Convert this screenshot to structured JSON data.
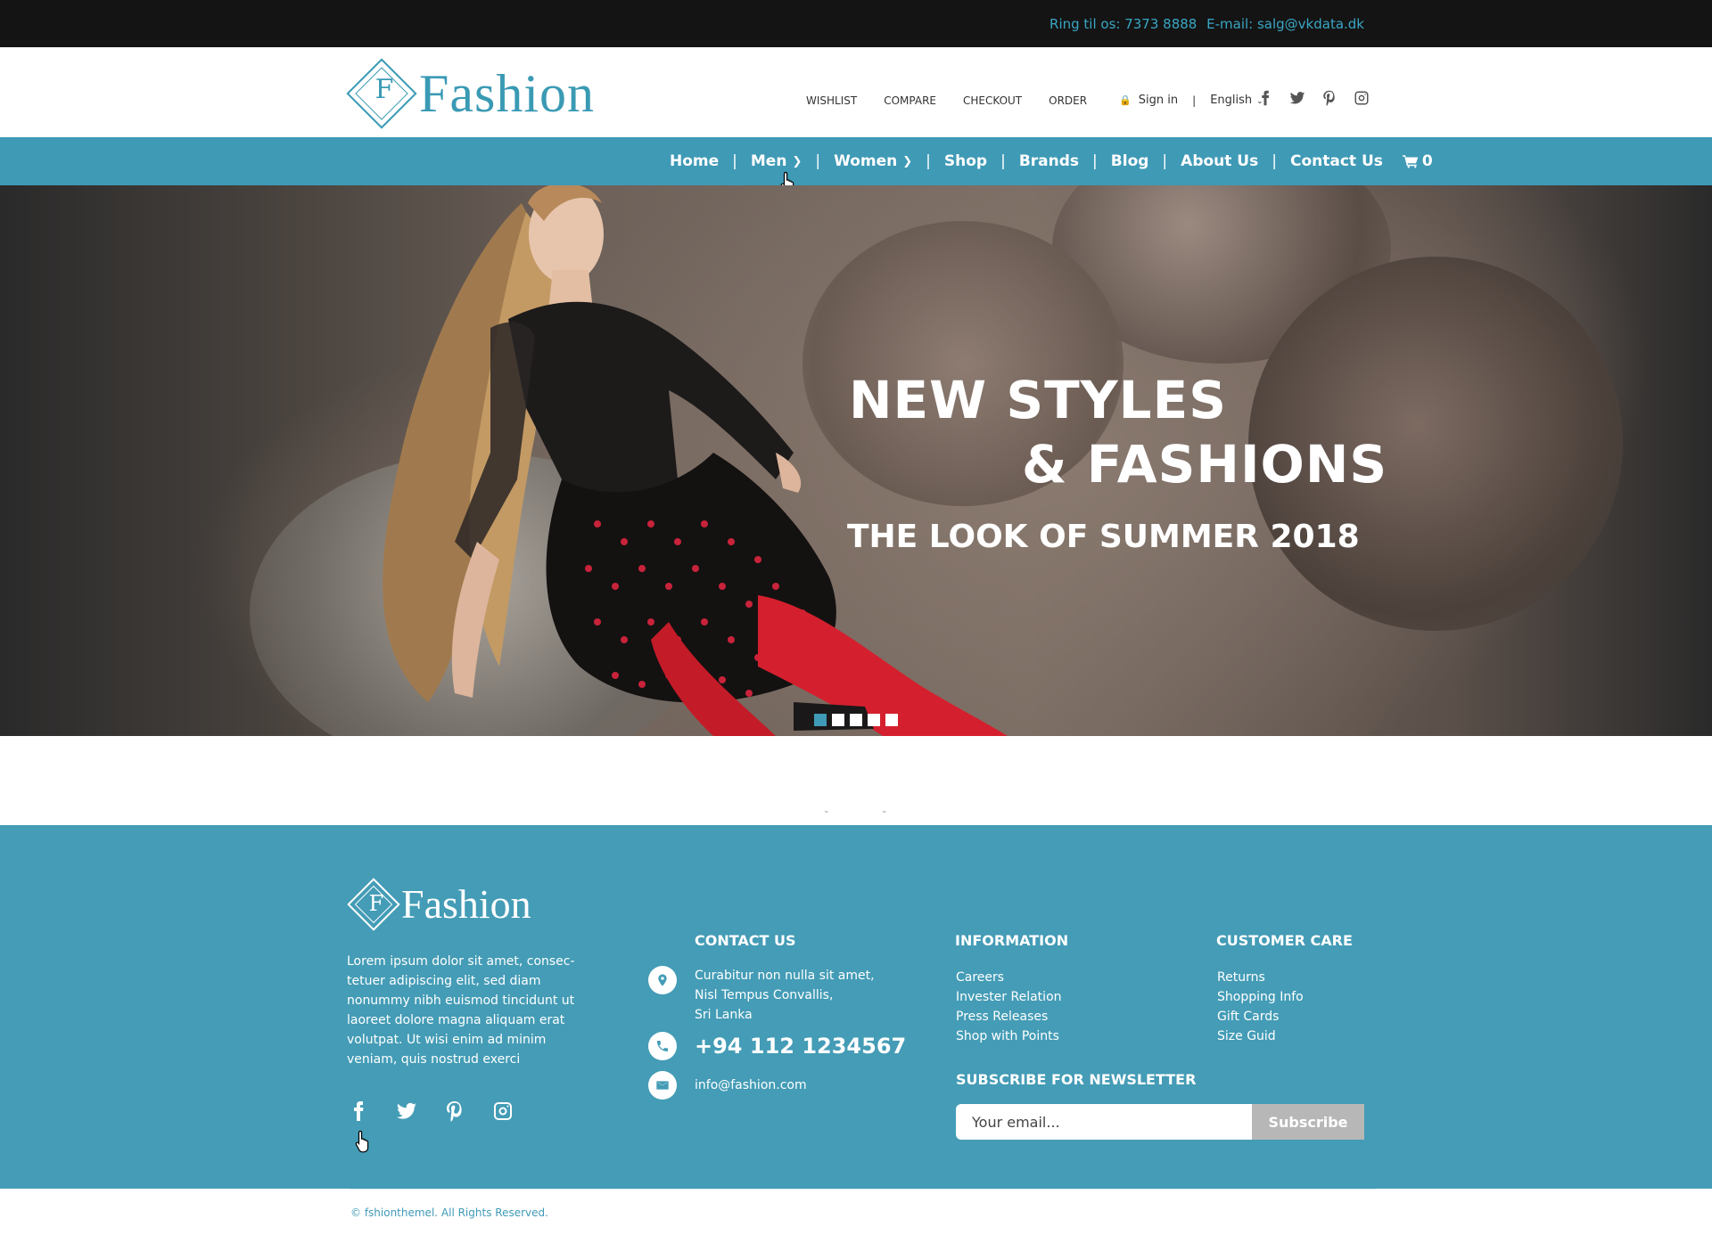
{
  "topbar": {
    "phone": "Ring til os: 7373 8888",
    "email": "E-mail: salg@vkdata.dk"
  },
  "header": {
    "logo_letter": "F",
    "logo_name": "Fashion",
    "links": [
      "WISHLIST",
      "COMPARE",
      "CHECKOUT",
      "ORDER"
    ],
    "signin": "Sign in",
    "separator": "|",
    "language": "English",
    "social_icons": [
      "facebook-icon",
      "twitter-icon",
      "pinterest-icon",
      "instagram-icon"
    ]
  },
  "mainnav": {
    "items": [
      "Home",
      "Men",
      "Women",
      "Shop",
      "Brands",
      "Blog",
      "About Us",
      "Contact Us"
    ],
    "cart_count": "0",
    "divider": "|"
  },
  "hero": {
    "line1": "NEW STYLES",
    "line2": "& FASHIONS",
    "subtitle": "THE LOOK OF SUMMER 2018",
    "slides": 5,
    "active_slide": 1
  },
  "footer": {
    "logo_letter": "F",
    "logo_name": "Fashion",
    "about": "Lorem ipsum dolor sit amet, consec-tetuer adipiscing elit, sed diam nonummy nibh euismod tincidunt ut laoreet dolore magna aliquam erat volutpat. Ut wisi enim ad minim veniam, quis nostrud exerci",
    "contact_title": "CONTACT US",
    "address": [
      "Curabitur non nulla sit amet,",
      "Nisl Tempus Convallis,",
      "Sri Lanka"
    ],
    "phone": "+94 112 1234567",
    "email": "info@fashion.com",
    "information_title": "INFORMATION",
    "information_links": [
      "Careers",
      "Invester Relation",
      "Press Releases",
      "Shop with Points"
    ],
    "care_title": "CUSTOMER CARE",
    "care_links": [
      "Returns",
      "Shopping Info",
      "Gift Cards",
      "Size Guid"
    ],
    "newsletter_title": "SUBSCRIBE FOR NEWSLETTER",
    "newsletter_placeholder": "Your email...",
    "subscribe_label": "Subscribe",
    "copyright": "© fshionthemel. All Rights Reserved."
  },
  "colors": {
    "accent": "#3f9ab6",
    "footer_bg": "#449cb6",
    "topbar_bg": "#141414",
    "button_gray": "#b7b7b7"
  }
}
